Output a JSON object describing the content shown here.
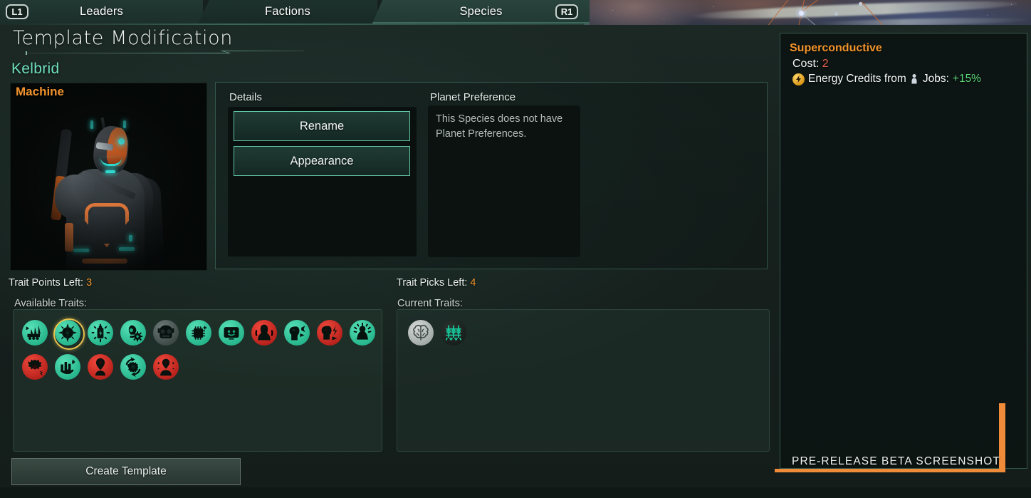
{
  "topbar": {
    "left_bumper": "L1",
    "right_bumper": "R1",
    "tabs": [
      {
        "label": "Leaders",
        "active": false
      },
      {
        "label": "Factions",
        "active": false
      },
      {
        "label": "Species",
        "active": true
      }
    ]
  },
  "header": {
    "title": "Template Modification"
  },
  "species": {
    "name": "Kelbrid",
    "class_label": "Machine",
    "name_color": "#6fe0bc",
    "class_color": "#f0932d"
  },
  "details": {
    "heading": "Details",
    "rename_label": "Rename",
    "appearance_label": "Appearance"
  },
  "planet_preference": {
    "heading": "Planet Preference",
    "body": "This Species does not have Planet Preferences."
  },
  "counters": {
    "points_label": "Trait Points Left:",
    "points_value": "3",
    "picks_label": "Trait Picks Left:",
    "picks_value": "4",
    "accent_color": "#f0932d"
  },
  "available_traits": {
    "label": "Available Traits:",
    "items": [
      {
        "name": "trait-mass-produced",
        "tone": "green",
        "icon": "factory-conveyor"
      },
      {
        "name": "trait-superconductive",
        "tone": "green",
        "icon": "lightning-burst",
        "selected": true
      },
      {
        "name": "trait-power-drills",
        "tone": "green",
        "icon": "battery-rays"
      },
      {
        "name": "trait-efficient-processors",
        "tone": "green",
        "icon": "bulb-gear"
      },
      {
        "name": "trait-double-jointed",
        "tone": "grey",
        "icon": "robot-face-dark"
      },
      {
        "name": "trait-logic-engines",
        "tone": "green",
        "icon": "chip-spark"
      },
      {
        "name": "trait-emotion-emulators",
        "tone": "green",
        "icon": "screen-smile"
      },
      {
        "name": "trait-bulky",
        "tone": "red",
        "icon": "bulky-figure"
      },
      {
        "name": "trait-propaganda-machines",
        "tone": "green",
        "icon": "head-speech"
      },
      {
        "name": "trait-uncanny",
        "tone": "red",
        "icon": "head-shock"
      },
      {
        "name": "trait-luminous",
        "tone": "green",
        "icon": "head-rays"
      },
      {
        "name": "trait-high-maintenance",
        "tone": "red",
        "icon": "broken-gear"
      },
      {
        "name": "trait-harvesters",
        "tone": "green",
        "icon": "hand-grain"
      },
      {
        "name": "trait-recycled",
        "tone": "red",
        "icon": "pin-figure"
      },
      {
        "name": "trait-streamlined",
        "tone": "green",
        "icon": "gear-cycle"
      },
      {
        "name": "trait-repurposed",
        "tone": "red",
        "icon": "figure-pin-red"
      }
    ]
  },
  "current_traits": {
    "label": "Current Traits:",
    "items": [
      {
        "name": "trait-intelligent",
        "tone": "lgrey",
        "icon": "brain"
      },
      {
        "name": "trait-robotic",
        "tone": "dark",
        "icon": "machine-circuit"
      }
    ]
  },
  "actions": {
    "create_template_label": "Create Template"
  },
  "tooltip": {
    "title": "Superconductive",
    "title_color": "#f0932d",
    "cost_label": "Cost:",
    "cost_value": "2",
    "cost_value_color": "#e8604f",
    "effect_prefix": "Energy Credits from",
    "effect_middle": "Jobs:",
    "effect_value": "+15%",
    "effect_value_color": "#5bd97a",
    "energy_icon": "energy-credits-icon",
    "pop_icon": "pop-jobs-icon"
  },
  "watermark": {
    "text": "PRE-RELEASE BETA SCREENSHOT",
    "bar_color": "#f08b39"
  }
}
